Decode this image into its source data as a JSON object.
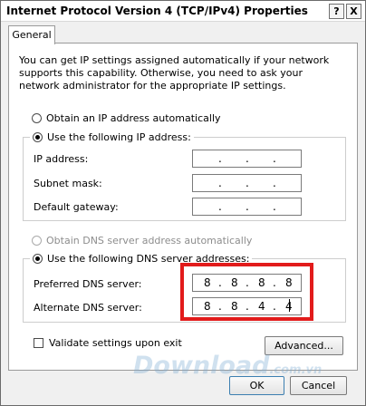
{
  "window": {
    "title": "Internet Protocol Version 4 (TCP/IPv4) Properties",
    "help_button": "?",
    "close_button": "X"
  },
  "tabs": [
    {
      "label": "General"
    }
  ],
  "intro_text": "You can get IP settings assigned automatically if your network supports this capability. Otherwise, you need to ask your network administrator for the appropriate IP settings.",
  "ip": {
    "auto_label": "Obtain an IP address automatically",
    "manual_label": "Use the following IP address:",
    "fields": [
      {
        "label": "IP address:",
        "value": [
          " ",
          " ",
          " ",
          " "
        ]
      },
      {
        "label": "Subnet mask:",
        "value": [
          " ",
          " ",
          " ",
          " "
        ]
      },
      {
        "label": "Default gateway:",
        "value": [
          " ",
          " ",
          " ",
          " "
        ]
      }
    ]
  },
  "dns": {
    "auto_label": "Obtain DNS server address automatically",
    "manual_label": "Use the following DNS server addresses:",
    "preferred": {
      "label": "Preferred DNS server:",
      "octets": [
        "8",
        "8",
        "8",
        "8"
      ]
    },
    "alternate": {
      "label": "Alternate DNS server:",
      "octets": [
        "8",
        "8",
        "4",
        "4"
      ]
    }
  },
  "validate_label": "Validate settings upon exit",
  "buttons": {
    "advanced": "Advanced...",
    "ok": "OK",
    "cancel": "Cancel"
  },
  "watermark": {
    "text": "Download",
    "suffix": ".com.vn"
  },
  "colors": {
    "highlight": "#e21b1b",
    "watermark": "#78aad2"
  }
}
